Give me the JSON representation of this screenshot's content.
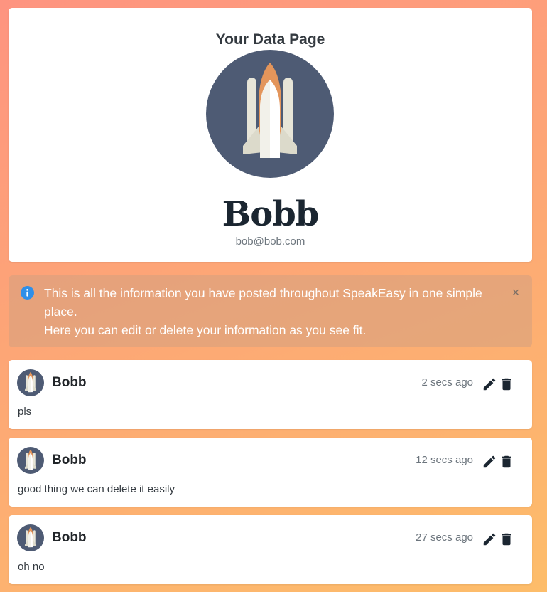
{
  "profile": {
    "title": "Your Data Page",
    "name": "Bobb",
    "email": "bob@bob.com",
    "avatar_icon": "rocket-icon"
  },
  "alert": {
    "icon": "info-icon",
    "line1": "This is all the information you have posted throughout SpeakEasy in one simple place.",
    "line2": "Here you can edit or delete your information as you see fit.",
    "close_label": "×"
  },
  "posts": [
    {
      "author": "Bobb",
      "time": "2 secs ago",
      "body": "pls"
    },
    {
      "author": "Bobb",
      "time": "12 secs ago",
      "body": "good thing we can delete it easily"
    },
    {
      "author": "Bobb",
      "time": "27 secs ago",
      "body": "oh no"
    }
  ],
  "colors": {
    "avatar_bg": "#4e5b74",
    "rocket_orange": "#e3955b",
    "info_blue": "#2f8fe9",
    "gradient_start": "#fe9480",
    "gradient_end": "#fdbd6a"
  }
}
